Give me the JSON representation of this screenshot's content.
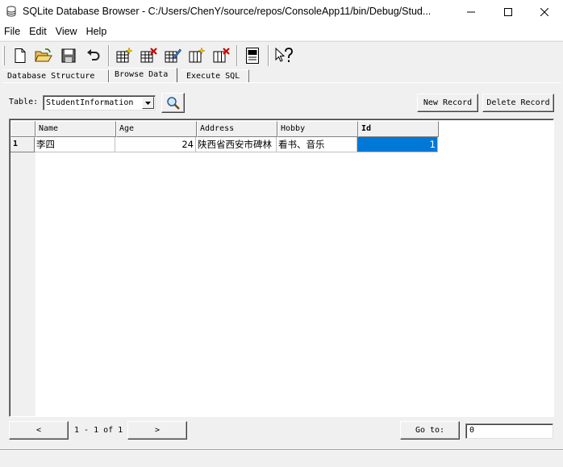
{
  "window": {
    "title": "SQLite Database Browser - C:/Users/ChenY/source/repos/ConsoleApp11/bin/Debug/Stud..."
  },
  "menu": [
    "File",
    "Edit",
    "View",
    "Help"
  ],
  "tabs": [
    {
      "label": "Database Structure",
      "active": false
    },
    {
      "label": "Browse Data",
      "active": true
    },
    {
      "label": "Execute SQL",
      "active": false
    }
  ],
  "browse": {
    "table_label": "Table:",
    "table_value": "StudentInformation",
    "new_record_label": "New Record",
    "delete_record_label": "Delete Record"
  },
  "grid": {
    "columns": [
      "Name",
      "Age",
      "Address",
      "Hobby",
      "Id"
    ],
    "rows": [
      {
        "num": "1",
        "cells": [
          "李四",
          "24",
          "陕西省西安市碑林",
          "看书、音乐",
          "1"
        ]
      }
    ]
  },
  "nav": {
    "prev_label": "<",
    "next_label": ">",
    "page_text": "1 - 1 of 1",
    "goto_label": "Go to:",
    "goto_value": "0"
  },
  "colors": {
    "selection": "#0078d7",
    "chrome": "#f0f0f0"
  }
}
